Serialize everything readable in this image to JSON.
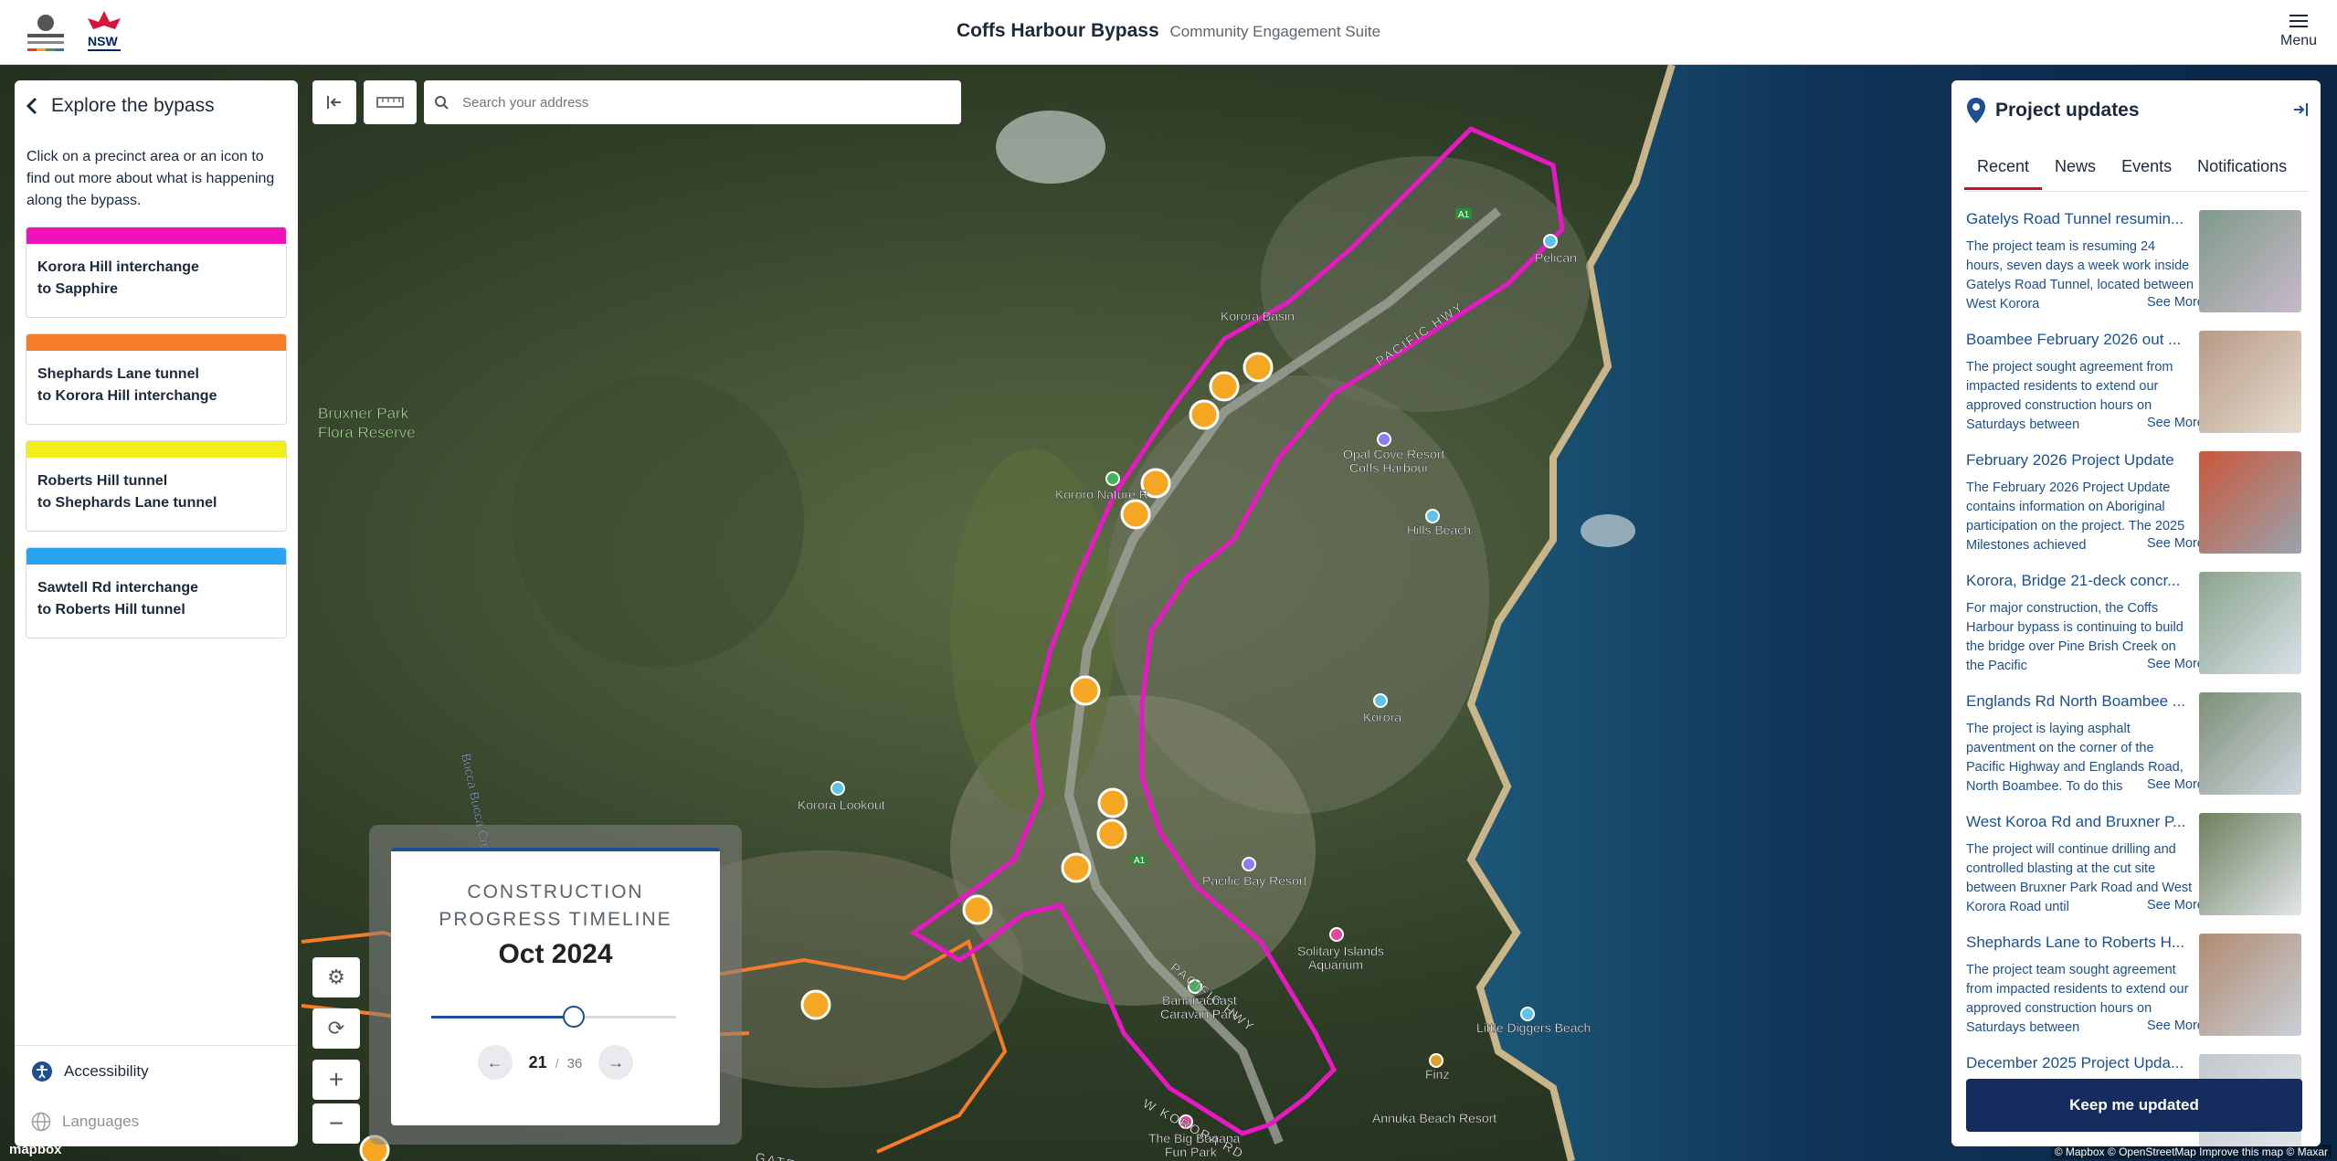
{
  "header": {
    "title": "Coffs Harbour Bypass",
    "subtitle": "Community Engagement Suite",
    "menu_label": "Menu",
    "logo_aus_text": "Australian Government",
    "logo_nsw_text": "NSW"
  },
  "search": {
    "placeholder": "Search your address"
  },
  "left_panel": {
    "title": "Explore the bypass",
    "intro": "Click on a precinct area or an icon to find out more about what is happening along the bypass.",
    "precincts": [
      {
        "line1": "Korora Hill interchange",
        "line2": "to Sapphire",
        "color": "#f012b8"
      },
      {
        "line1": "Shephards Lane tunnel",
        "line2": "to Korora Hill interchange",
        "color": "#f57c28"
      },
      {
        "line1": "Roberts Hill tunnel",
        "line2": "to Shephards Lane tunnel",
        "color": "#f2ee1a"
      },
      {
        "line1": "Sawtell Rd interchange",
        "line2": "to Roberts Hill tunnel",
        "color": "#2aa3f0"
      }
    ],
    "accessibility_label": "Accessibility",
    "languages_label": "Languages"
  },
  "map_labels": {
    "bruxner": "Bruxner Park\nFlora Reserve",
    "bucca_creek": "Bucca Bucca Creek",
    "korora_lookout": "Korora Lookout",
    "korora_basin": "Korora Basin",
    "pacific_hwy_1": "PACIFIC HWY",
    "pacific_hwy_2": "PACIFIC HWY",
    "pelican": "Pelican",
    "opal_cove": "Opal Cove Resort\nCoffs Harbour",
    "hills_beach": "Hills Beach",
    "korora": "Korora",
    "pacific_bay": "Pacific Bay Resort",
    "solitary": "Solitary Islands\nAquarium",
    "bananacoast": "Bananacoast\nCaravan Park",
    "little_diggers": "Little Diggers Beach",
    "finz": "Finz",
    "annuka": "Annuka Beach Resort",
    "big_banana": "The Big Banana\nFun Park",
    "w_korora_rd": "W KORORA RD",
    "gatelys_rd": "GATELYS RD",
    "kororo_nature": "Kororo Nature R",
    "a1": "A1"
  },
  "timeline": {
    "title": "CONSTRUCTION PROGRESS TIMELINE",
    "date": "Oct 2024",
    "current": "21",
    "separator": "/",
    "total": "36",
    "progress_fraction": 0.583
  },
  "right_panel": {
    "title": "Project updates",
    "tabs": [
      "Recent",
      "News",
      "Events",
      "Notifications"
    ],
    "active_tab": "Recent",
    "see_more": "See More",
    "news": [
      {
        "title": "Gatelys Road Tunnel resumin...",
        "body": "The project team is resuming 24 hours, seven days a week work inside Gatelys Road Tunnel, located between West Korora"
      },
      {
        "title": "Boambee February 2026 out ...",
        "body": "The project sought agreement from impacted residents to extend our approved construction hours on Saturdays between"
      },
      {
        "title": "February 2026 Project Update",
        "body": "The February 2026 Project Update contains information on Aboriginal participation on the project. The 2025 Milestones achieved"
      },
      {
        "title": "Korora, Bridge 21-deck concr...",
        "body": "For major construction, the Coffs Harbour bypass is continuing to build the bridge over Pine Brish Creek on the Pacific"
      },
      {
        "title": "Englands Rd North Boambee ...",
        "body": "The project is laying asphalt paventment on the corner of the Pacific Highway and Englands Road, North Boambee. To do this"
      },
      {
        "title": "West Koroa Rd and Bruxner P...",
        "body": "The project will continue drilling and controlled blasting at the cut site between Bruxner Park Road and West Korora Road until"
      },
      {
        "title": "Shephards Lane to Roberts H...",
        "body": "The project team sought agreement from impacted residents to extend our approved construction hours on Saturdays between"
      },
      {
        "title": "December 2025 Project Upda...",
        "body": ""
      }
    ],
    "keep_updated": "Keep me updated"
  },
  "credits": {
    "mapbox": "mapbox",
    "attribution": "© Mapbox © OpenStreetMap  Improve this map © Maxar"
  },
  "colors": {
    "accent_red": "#c8102e",
    "navy": "#142d5e",
    "link_blue": "#1d4f91",
    "bypass_magenta": "#e619c3"
  }
}
